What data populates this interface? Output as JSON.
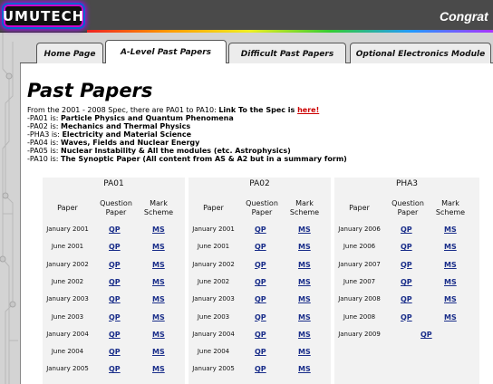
{
  "logo": "UMUTECH",
  "header_text": "Congrat",
  "nav": {
    "tabs": [
      "Home Page",
      "A-Level Past Papers",
      "Difficult Past Papers",
      "Optional Electronics Module"
    ]
  },
  "page_title": "Past Papers",
  "intro": {
    "lead": "From the 2001 - 2008 Spec, there are PA01 to PA10: ",
    "link_lead": "Link To the Spec is ",
    "link_text": "here!",
    "modules": [
      {
        "code": "-PA01 is: ",
        "name": "Particle Physics and Quantum Phenomena"
      },
      {
        "code": "-PA02 is: ",
        "name": "Mechanics and Thermal Physics"
      },
      {
        "code": "-PHA3 is: ",
        "name": "Electricity and Material Science"
      },
      {
        "code": "-PA04 is: ",
        "name": "Waves, Fields and Nuclear Energy"
      },
      {
        "code": "-PA05 is: ",
        "name": "Nuclear Instability & All the modules (etc. Astrophysics)"
      },
      {
        "code": "-PA10 is: ",
        "name": "The Synoptic Paper (All content from AS & A2 but in a summary form)"
      }
    ]
  },
  "table_headers": {
    "paper": "Paper",
    "question_paper": "Question Paper",
    "mark_scheme": "Mark Scheme"
  },
  "columns": [
    {
      "title": "PA01",
      "rows": [
        {
          "paper": "January 2001",
          "qp": "QP",
          "ms": "MS"
        },
        {
          "paper": "June 2001",
          "qp": "QP",
          "ms": "MS"
        },
        {
          "paper": "January 2002",
          "qp": "QP",
          "ms": "MS"
        },
        {
          "paper": "June 2002",
          "qp": "QP",
          "ms": "MS"
        },
        {
          "paper": "January 2003",
          "qp": "QP",
          "ms": "MS"
        },
        {
          "paper": "June 2003",
          "qp": "QP",
          "ms": "MS"
        },
        {
          "paper": "January 2004",
          "qp": "QP",
          "ms": "MS"
        },
        {
          "paper": "June 2004",
          "qp": "QP",
          "ms": "MS"
        },
        {
          "paper": "January 2005",
          "qp": "QP",
          "ms": "MS"
        }
      ]
    },
    {
      "title": "PA02",
      "rows": [
        {
          "paper": "January 2001",
          "qp": "QP",
          "ms": "MS"
        },
        {
          "paper": "June 2001",
          "qp": "QP",
          "ms": "MS"
        },
        {
          "paper": "January 2002",
          "qp": "QP",
          "ms": "MS"
        },
        {
          "paper": "June 2002",
          "qp": "QP",
          "ms": "MS"
        },
        {
          "paper": "January 2003",
          "qp": "QP",
          "ms": "MS"
        },
        {
          "paper": "June 2003",
          "qp": "QP",
          "ms": "MS"
        },
        {
          "paper": "January 2004",
          "qp": "QP",
          "ms": "MS"
        },
        {
          "paper": "June 2004",
          "qp": "QP",
          "ms": "MS"
        },
        {
          "paper": "January 2005",
          "qp": "QP",
          "ms": "MS"
        }
      ]
    },
    {
      "title": "PHA3",
      "rows": [
        {
          "paper": "January 2006",
          "qp": "QP",
          "ms": "MS"
        },
        {
          "paper": "June 2006",
          "qp": "QP",
          "ms": "MS"
        },
        {
          "paper": "January 2007",
          "qp": "QP",
          "ms": "MS"
        },
        {
          "paper": "June 2007",
          "qp": "QP",
          "ms": "MS"
        },
        {
          "paper": "January 2008",
          "qp": "QP",
          "ms": "MS"
        },
        {
          "paper": "June 2008",
          "qp": "QP",
          "ms": "MS"
        },
        {
          "paper": "January 2009",
          "qp": "QP",
          "ms": ""
        }
      ]
    }
  ],
  "colors": {
    "header_bg": "#4a4a4a",
    "link_red": "#cc0000",
    "link_blue": "#1a2e8a",
    "table_bg": "#f2f2f2"
  }
}
